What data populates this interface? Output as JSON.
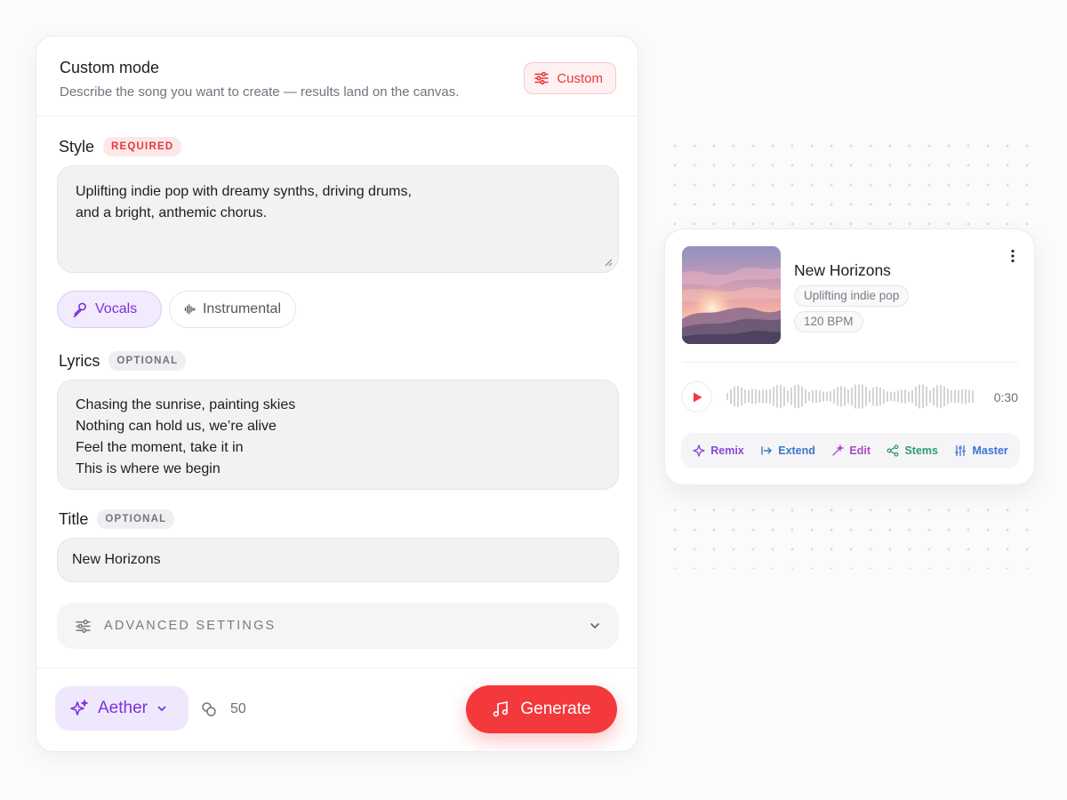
{
  "form": {
    "title": "Custom mode",
    "subtitle": "Describe the song you want to create — results land on the canvas.",
    "mode_button": "Custom",
    "style": {
      "label": "Style",
      "badge": "REQUIRED",
      "value_lines": [
        "Uplifting indie pop with dreamy synths, driving drums,",
        "and a bright, anthemic chorus."
      ]
    },
    "vocal_toggle": {
      "vocals": "Vocals",
      "instrumental": "Instrumental",
      "selected": "Vocals"
    },
    "lyrics": {
      "label": "Lyrics",
      "badge": "OPTIONAL",
      "lines": [
        "Chasing the sunrise, painting skies",
        "Nothing can hold us, we’re alive",
        "Feel the moment, take it in",
        "This is where we begin"
      ]
    },
    "title_field": {
      "label": "Title",
      "badge": "OPTIONAL",
      "value": "New Horizons"
    },
    "advanced": {
      "label": "ADVANCED SETTINGS"
    },
    "footer": {
      "model": "Aether",
      "credits": "50",
      "generate": "Generate"
    }
  },
  "result_card": {
    "title": "New Horizons",
    "tags": [
      "Uplifting indie pop",
      "120 BPM"
    ],
    "duration": "0:30",
    "actions": [
      {
        "label": "Remix",
        "icon": "remix-icon",
        "color": "#8a46d8"
      },
      {
        "label": "Extend",
        "icon": "extend-icon",
        "color": "#3a78c6"
      },
      {
        "label": "Edit",
        "icon": "edit-icon",
        "color": "#b048c8"
      },
      {
        "label": "Stems",
        "icon": "stems-icon",
        "color": "#2f9a78"
      },
      {
        "label": "Master",
        "icon": "master-icon",
        "color": "#3c74d8"
      }
    ]
  },
  "colors": {
    "accent_red": "#f3393c",
    "accent_purple": "#7a31e0"
  }
}
